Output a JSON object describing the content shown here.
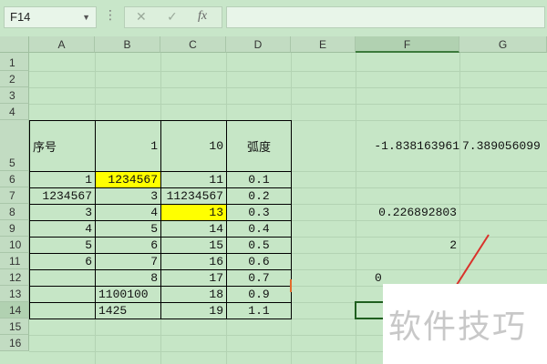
{
  "formula_bar": {
    "name_box": "F14",
    "cancel_icon": "✕",
    "enter_icon": "✓",
    "fx_label": "fx",
    "formula": ""
  },
  "columns": [
    "A",
    "B",
    "C",
    "D",
    "E",
    "F",
    "G"
  ],
  "rows": [
    "1",
    "2",
    "3",
    "4",
    "5",
    "6",
    "7",
    "8",
    "9",
    "10",
    "11",
    "12",
    "13",
    "14",
    "15",
    "16"
  ],
  "cells": {
    "A5": "序号",
    "B5": "1",
    "C5": "10",
    "D5": "弧度",
    "F5": "-1.838163961",
    "G5": "7.389056099",
    "A6": "1",
    "B6": "1234567",
    "C6": "11",
    "D6": "0.1",
    "A7": "1234567",
    "B7": "3",
    "C7": "11234567",
    "D7": "0.2",
    "A8": "3",
    "B8": "4",
    "C8": "13",
    "D8": "0.3",
    "F8": "0.226892803",
    "A9": "4",
    "B9": "5",
    "C9": "14",
    "D9": "0.4",
    "A10": "5",
    "B10": "6",
    "C10": "15",
    "D10": "0.5",
    "F10": "2",
    "A11": "6",
    "B11": "7",
    "C11": "16",
    "D11": "0.6",
    "B12": "8",
    "C12": "17",
    "D12": "0.7",
    "F12": "0",
    "B13": "1100100",
    "C13": "18",
    "D13": "0.9",
    "B14": "1425",
    "C14": "19",
    "D14": "1.1"
  },
  "highlight_color": "#ffff00",
  "selected_cell": "F14",
  "watermark": "软件技巧"
}
